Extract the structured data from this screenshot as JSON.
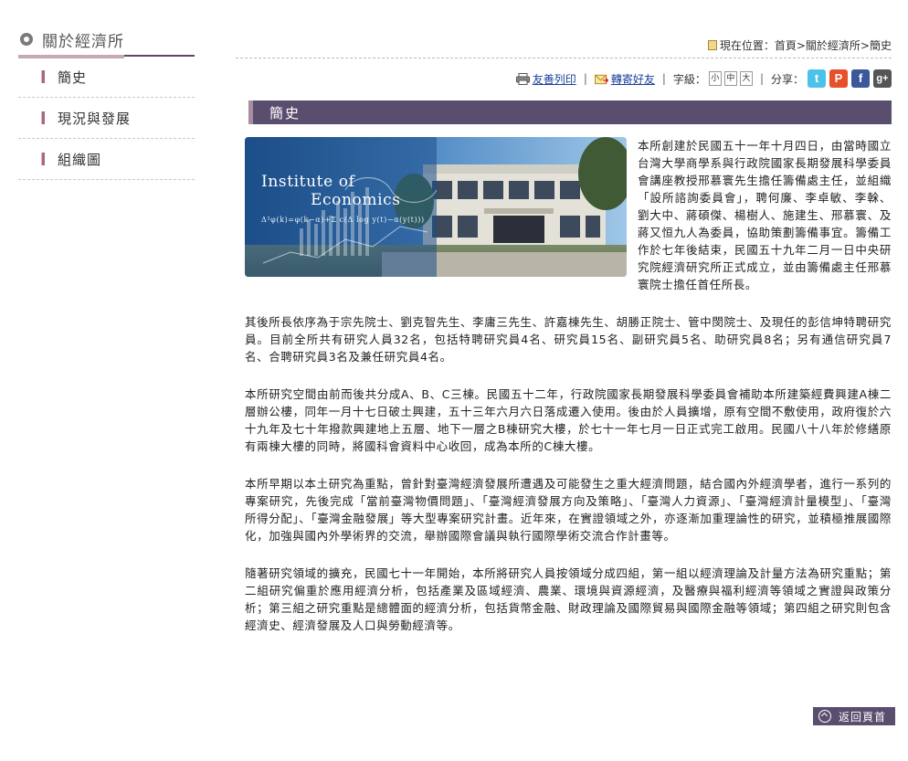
{
  "sidebar": {
    "title": "關於經濟所",
    "items": [
      {
        "label": "簡史"
      },
      {
        "label": "現況與發展"
      },
      {
        "label": "組織圖"
      }
    ]
  },
  "breadcrumb": {
    "prefix": "現在位置：",
    "home": "首頁",
    "sep": ">",
    "parent": "關於經濟所",
    "current": "簡史"
  },
  "toolbar": {
    "print_label": "友善列印",
    "forward_label": "轉寄好友",
    "font_size_label": "字級：",
    "font_sizes": [
      "小",
      "中",
      "大"
    ],
    "share_label": "分享："
  },
  "section_title": "簡史",
  "hero": {
    "line1": "Institute of",
    "line2": "Economics",
    "formula": "Δ²φ(k)=φ(k−α)+Σ c(Δ log y(t)−α(y(t)))"
  },
  "paragraphs": [
    "本所創建於民國五十一年十月四日，由當時國立台灣大學商學系與行政院國家長期發展科學委員會講座教授邢慕寰先生擔任籌備處主任，並組織「設所諮詢委員會」，聘何廉、李卓敏、李榦、劉大中、蔣碩傑、楊樹人、施建生、邢慕寰、及蔣又恒九人為委員，協助策劃籌備事宜。籌備工作於七年後結束，民國五十九年二月一日中央研究院經濟研究所正式成立，並由籌備處主任邢慕寰院士擔任首任所長。",
    "其後所長依序為于宗先院士、劉克智先生、李庸三先生、許嘉棟先生、胡勝正院士、管中閔院士、及現任的彭信坤特聘研究員。目前全所共有研究人員32名，包括特聘研究員4名、研究員15名、副研究員5名、助研究員8名；另有通信研究員7名、合聘研究員3名及兼任研究員4名。",
    "本所研究空間由前而後共分成A、B、C三棟。民國五十二年，行政院國家長期發展科學委員會補助本所建築經費興建A棟二層辦公樓，同年一月十七日破土興建，五十三年六月六日落成遷入使用。後由於人員擴增，原有空間不敷使用，政府復於六十九年及七十年撥款興建地上五層、地下一層之B棟研究大樓，於七十一年七月一日正式完工啟用。民國八十八年於修繕原有兩棟大樓的同時，將國科會資料中心收回，成為本所的C棟大樓。",
    "本所早期以本土研究為重點，曾針對臺灣經濟發展所遭遇及可能發生之重大經濟問題，結合國內外經濟學者，進行一系列的專案研究，先後完成「當前臺灣物價問題」、「臺灣經濟發展方向及策略」、「臺灣人力資源」、「臺灣經濟計量模型」、「臺灣所得分配」、「臺灣金融發展」等大型專案研究計畫。近年來，在實證領域之外，亦逐漸加重理論性的研究，並積極推展國際化，加強與國內外學術界的交流，舉辦國際會議與執行國際學術交流合作計畫等。",
    "隨著研究領域的擴充，民國七十一年開始，本所將研究人員按領域分成四組，第一組以經濟理論及計量方法為研究重點；第二組研究偏重於應用經濟分析，包括產業及區域經濟、農業、環境與資源經濟，及醫療與福利經濟等領域之實證與政策分析；第三組之研究重點是總體面的經濟分析，包括貨幣金融、財政理論及國際貿易與國際金融等領域；第四組之研究則包含經濟史、經濟發展及人口與勞動經濟等。"
  ],
  "back_to_top": "返回頁首",
  "colors": {
    "section_bar": "#5a4e6e",
    "link": "#1a3f9c",
    "side_mark": "#a86a7a"
  }
}
